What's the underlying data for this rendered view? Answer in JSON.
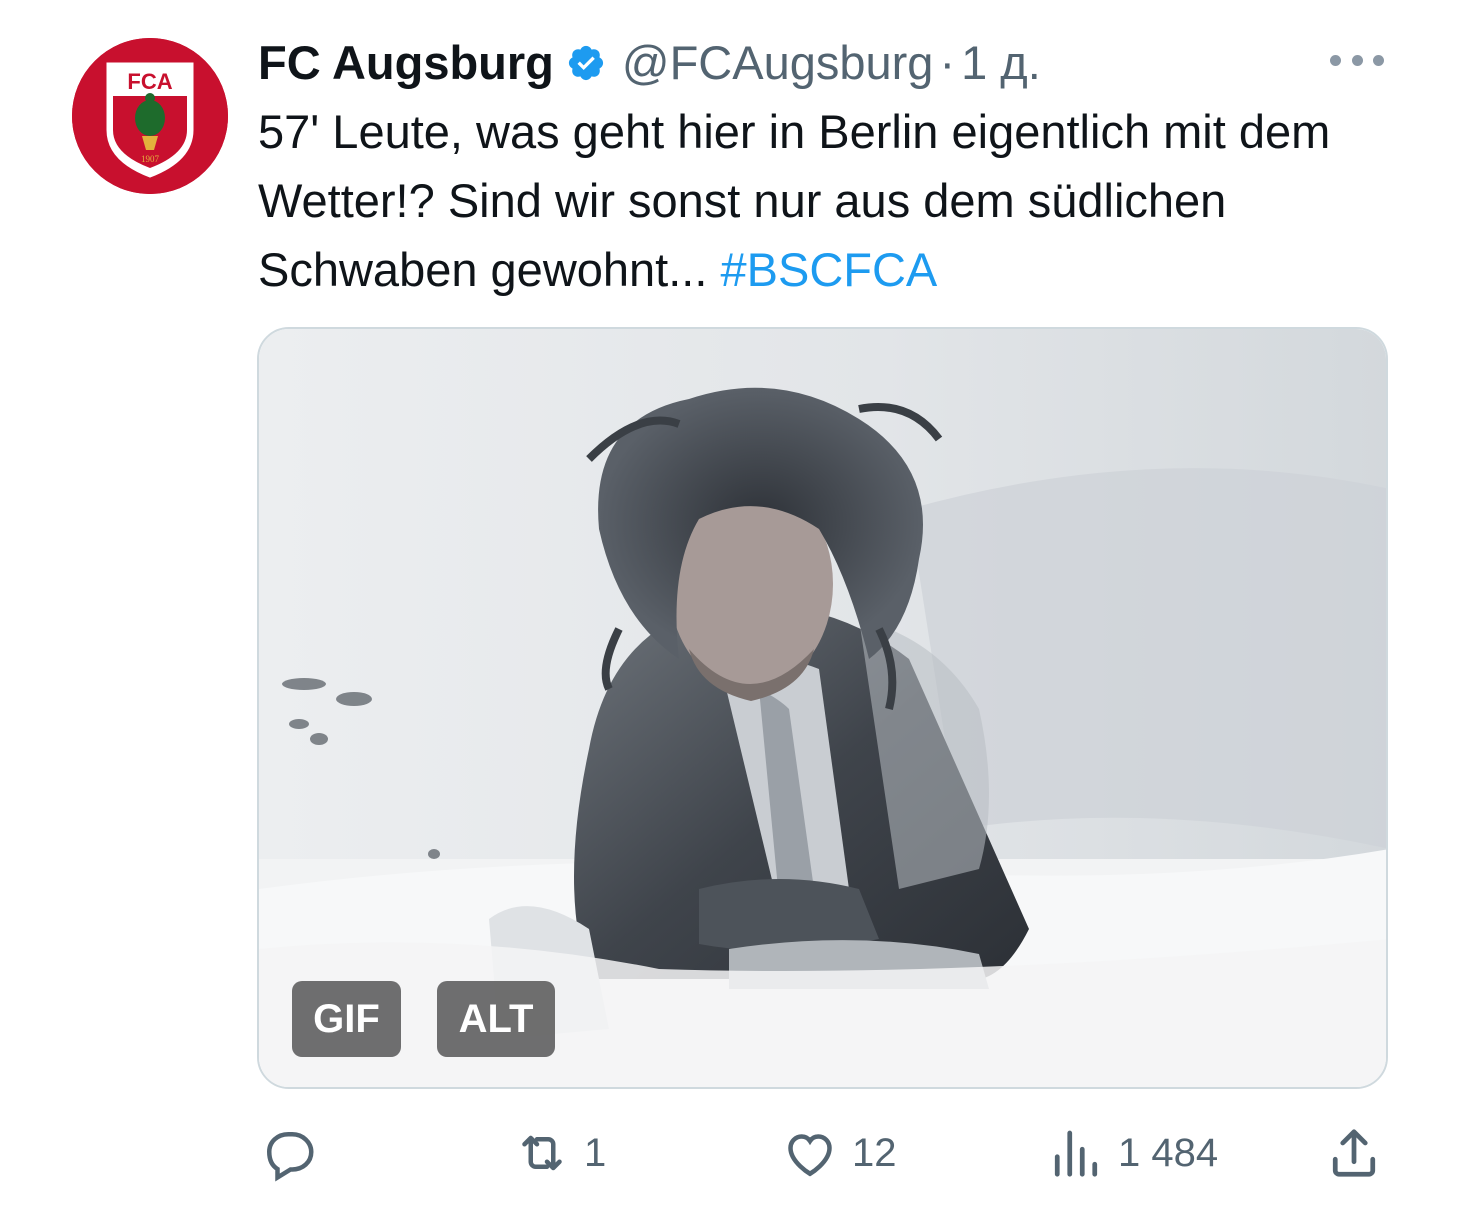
{
  "tweet": {
    "author_name": "FC Augsburg",
    "handle": "@FCAugsburg",
    "separator": "·",
    "time": "1 д.",
    "text_main": "57' Leute, was geht hier in Berlin eigentlich mit dem Wetter!? Sind wir sonst nur aus dem südlichen Schwaben gewohnt... ",
    "hashtag": "#BSCFCA",
    "avatar": {
      "icon": "fca-crest-logo",
      "logo_text": "FCA",
      "logo_year": "1907",
      "bg_color": "#c8102e"
    },
    "verified_icon": "verified-badge-icon",
    "media": {
      "type": "gif",
      "gif_badge": "GIF",
      "alt_badge": "ALT"
    },
    "actions": {
      "reply": {
        "icon": "reply-icon",
        "count": ""
      },
      "retweet": {
        "icon": "retweet-icon",
        "count": "1"
      },
      "like": {
        "icon": "heart-icon",
        "count": "12"
      },
      "views": {
        "icon": "views-icon",
        "count": "1 484"
      },
      "share": {
        "icon": "share-icon"
      }
    }
  },
  "colors": {
    "accent": "#1d9bf0",
    "secondary_text": "#536471",
    "primary_text": "#0f1419"
  }
}
